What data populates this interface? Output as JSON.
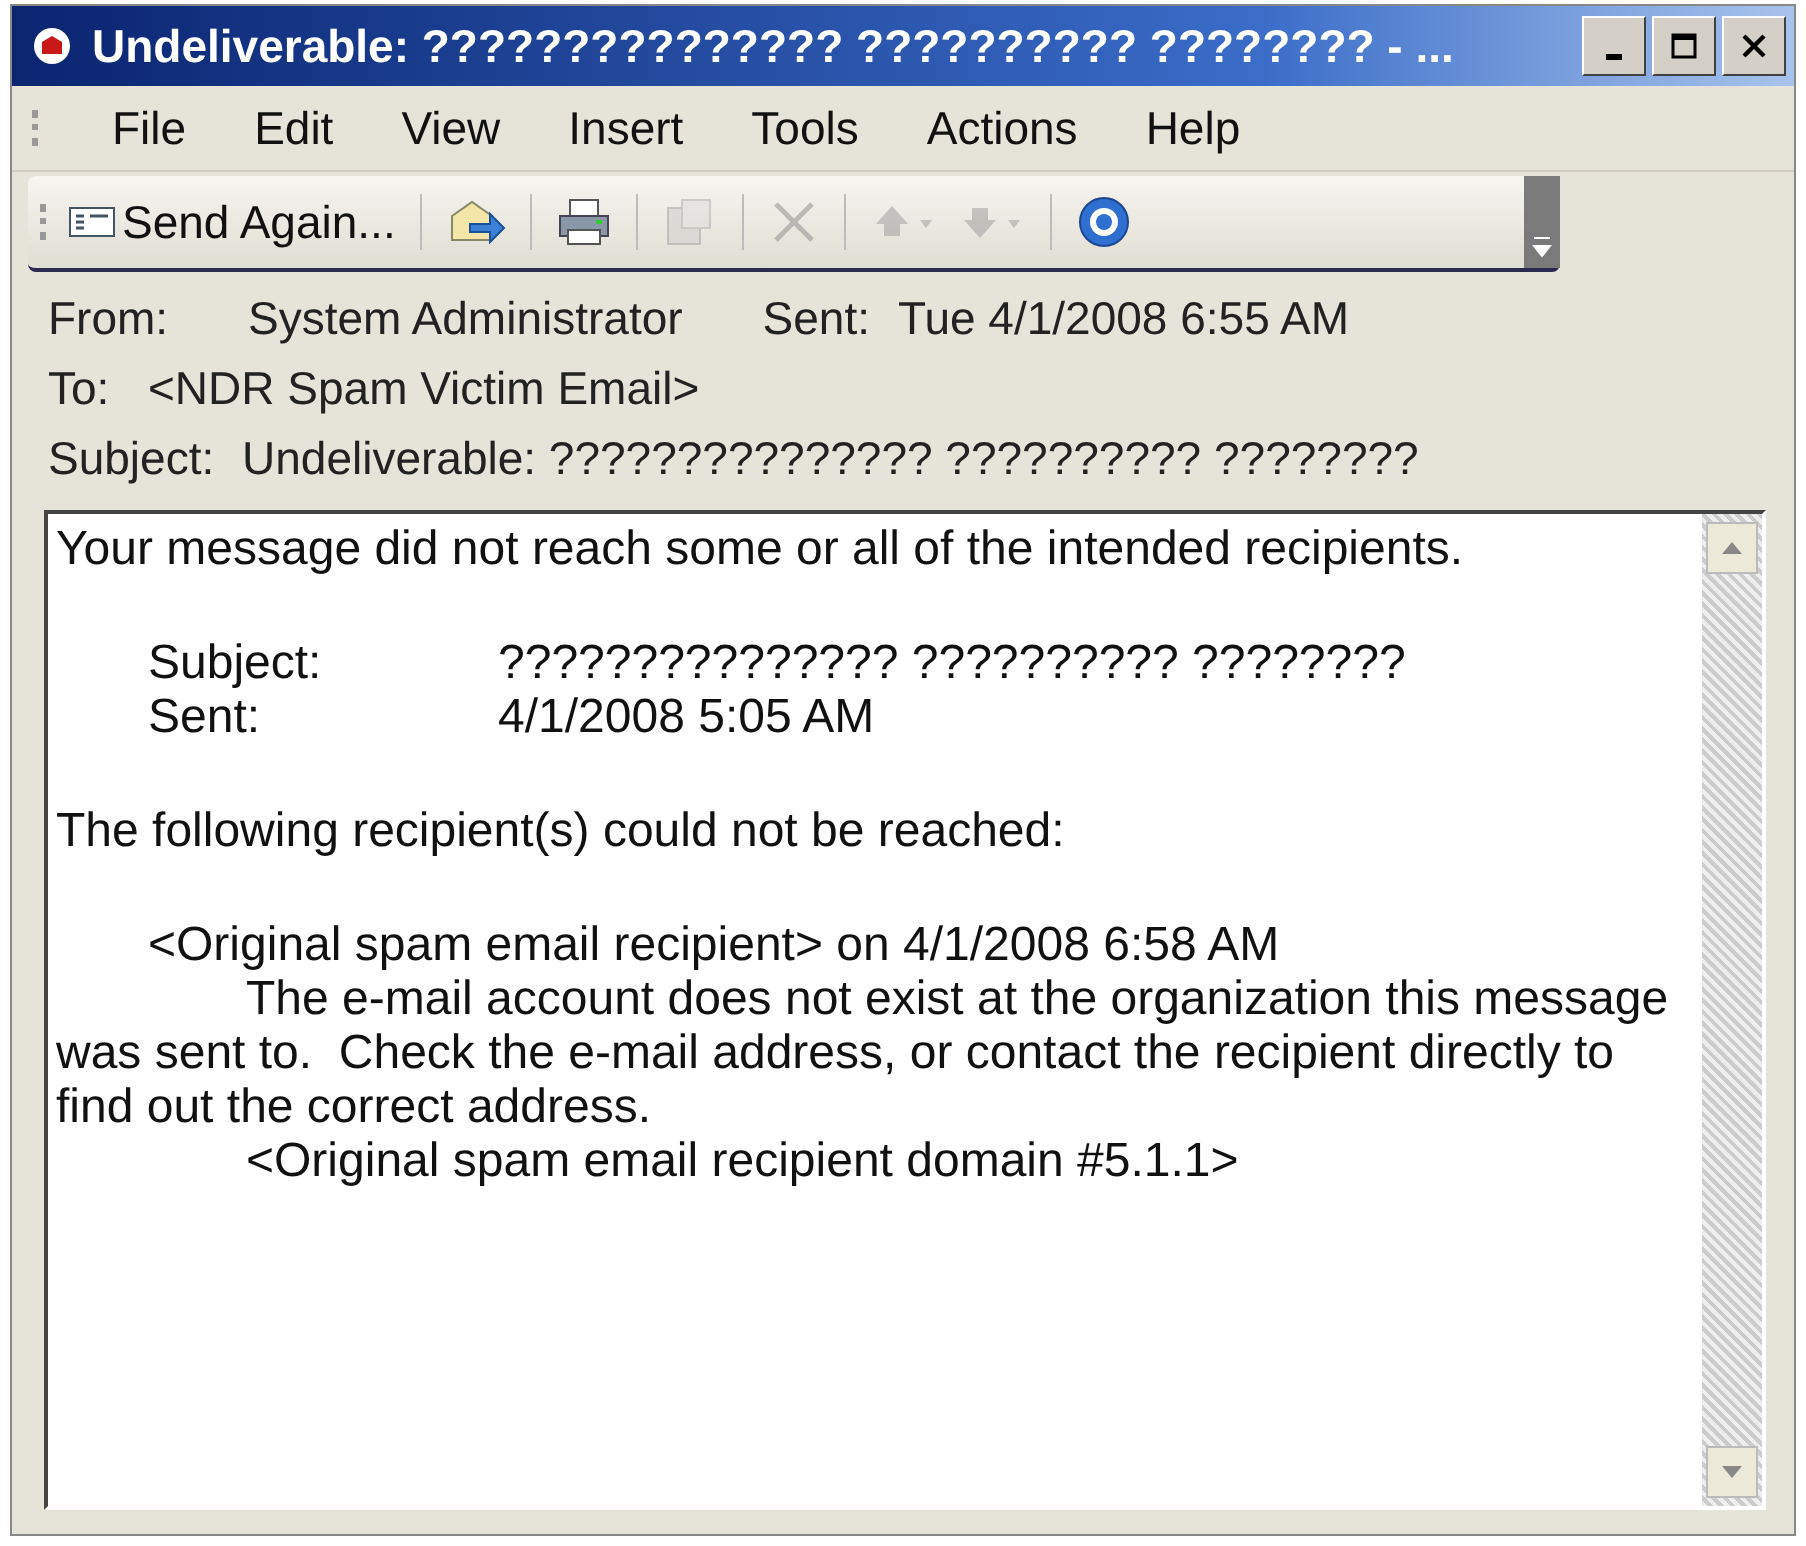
{
  "window": {
    "title": "Undeliverable: ??????????????? ?????????? ???????? - ..."
  },
  "menu": [
    "File",
    "Edit",
    "View",
    "Insert",
    "Tools",
    "Actions",
    "Help"
  ],
  "toolbar": [
    {
      "kind": "send",
      "label": "Send Again...",
      "disabled": false
    },
    {
      "kind": "forward",
      "disabled": false
    },
    {
      "kind": "print",
      "disabled": false
    },
    {
      "kind": "move",
      "disabled": true
    },
    {
      "kind": "delete",
      "disabled": true
    },
    {
      "kind": "up",
      "disabled": true
    },
    {
      "kind": "down",
      "disabled": true
    },
    {
      "kind": "help",
      "disabled": false
    }
  ],
  "header": {
    "from_label": "From:",
    "from": "System Administrator",
    "sent_label": "Sent:",
    "sent": "Tue 4/1/2008 6:55 AM",
    "to_label": "To:",
    "to": "<NDR Spam Victim Email>",
    "subject_label": "Subject:",
    "subject": "Undeliverable: ??????????????? ?????????? ????????"
  },
  "body": [
    {
      "kind": "plain",
      "text": "Your message did not reach some or all of the intended recipients."
    },
    {
      "kind": "gap"
    },
    {
      "kind": "field",
      "label": "Subject:",
      "text": "??????????????? ?????????? ????????"
    },
    {
      "kind": "field",
      "label": "Sent:",
      "text": "4/1/2008 5:05 AM"
    },
    {
      "kind": "gap"
    },
    {
      "kind": "plain",
      "text": "The following recipient(s) could not be reached:"
    },
    {
      "kind": "gap"
    },
    {
      "kind": "indented",
      "text": "<Original spam email recipient> on 4/1/2008 6:58 AM"
    },
    {
      "kind": "hanging",
      "text": "The e-mail account does not exist at the organization this message was sent to.  Check the e-mail address, or contact the recipient directly to find out the correct address."
    },
    {
      "kind": "deep",
      "text": "<Original spam email recipient domain #5.1.1>"
    }
  ]
}
